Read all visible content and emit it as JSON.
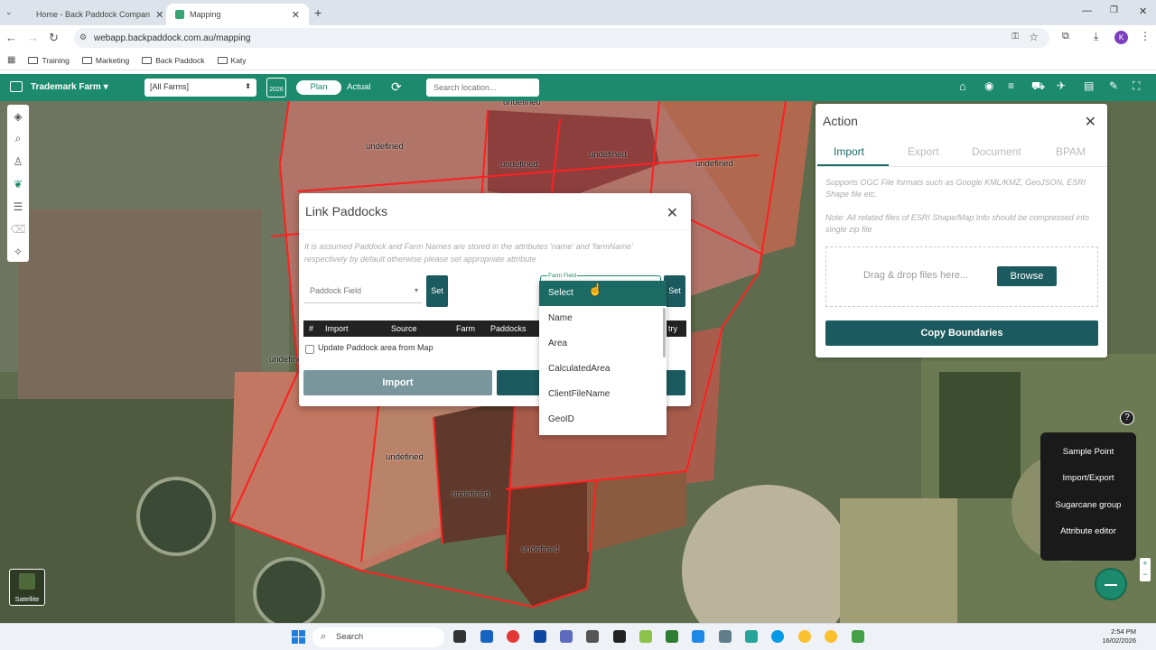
{
  "browser": {
    "tabs": [
      {
        "label": "Home - Back Paddock Compan",
        "active": false
      },
      {
        "label": "Mapping",
        "active": true
      }
    ],
    "url": "webapp.backpaddock.com.au/mapping",
    "profile_initial": "K",
    "bookmarks": [
      "Training",
      "Marketing",
      "Back Paddock",
      "Katy"
    ]
  },
  "app": {
    "farm_name": "Trademark Farm",
    "farm_filter": "[All Farms]",
    "year_badge": "2026",
    "plan_label": "Plan",
    "actual_label": "Actual",
    "search_placeholder": "Search location...",
    "accent_color": "#1c8a6c"
  },
  "map": {
    "labels": [
      "undefined",
      "undefined",
      "undefined",
      "undefined",
      "undefined",
      "undefined",
      "undefined",
      "undefined",
      "undefined",
      "undefined",
      "undefine"
    ],
    "satellite_label": "Satellite"
  },
  "dialog": {
    "title": "Link Paddocks",
    "note": "It is assumed Paddock and Farm Names are stored in the attributes 'name' and 'farmName' respectively by default otherwise please set appropriate attribute",
    "paddock_field_placeholder": "Paddock Field",
    "set_label": "Set",
    "farm_field_label": "Farm Field",
    "table_headers": [
      "#",
      "Import",
      "Source",
      "Farm",
      "Paddocks",
      "try"
    ],
    "update_checkbox_label": "Update Paddock area from Map",
    "import_button": "Import"
  },
  "dropdown": {
    "options": [
      "Select",
      "Name",
      "Area",
      "CalculatedArea",
      "ClientFileName",
      "GeoID"
    ],
    "selected": "Select"
  },
  "action_panel": {
    "title": "Action",
    "tabs": [
      "Import",
      "Export",
      "Document",
      "BPAM"
    ],
    "active_tab": "Import",
    "note1": "Supports OGC File formats such as Google KML/KMZ, GeoJSON, ESRI Shape file etc.",
    "note2": "Note: All related files of ESRI Shape/Map Info should be compressed into single zip file",
    "drop_text": "Drag & drop files here...",
    "browse_button": "Browse",
    "copy_button": "Copy Boundaries"
  },
  "floating_menu": [
    "Sample Point",
    "Import/Export",
    "Sugarcane group",
    "Attribute editor"
  ],
  "taskbar": {
    "search_label": "Search",
    "time": "2:54 PM",
    "date": "16/02/2026"
  }
}
